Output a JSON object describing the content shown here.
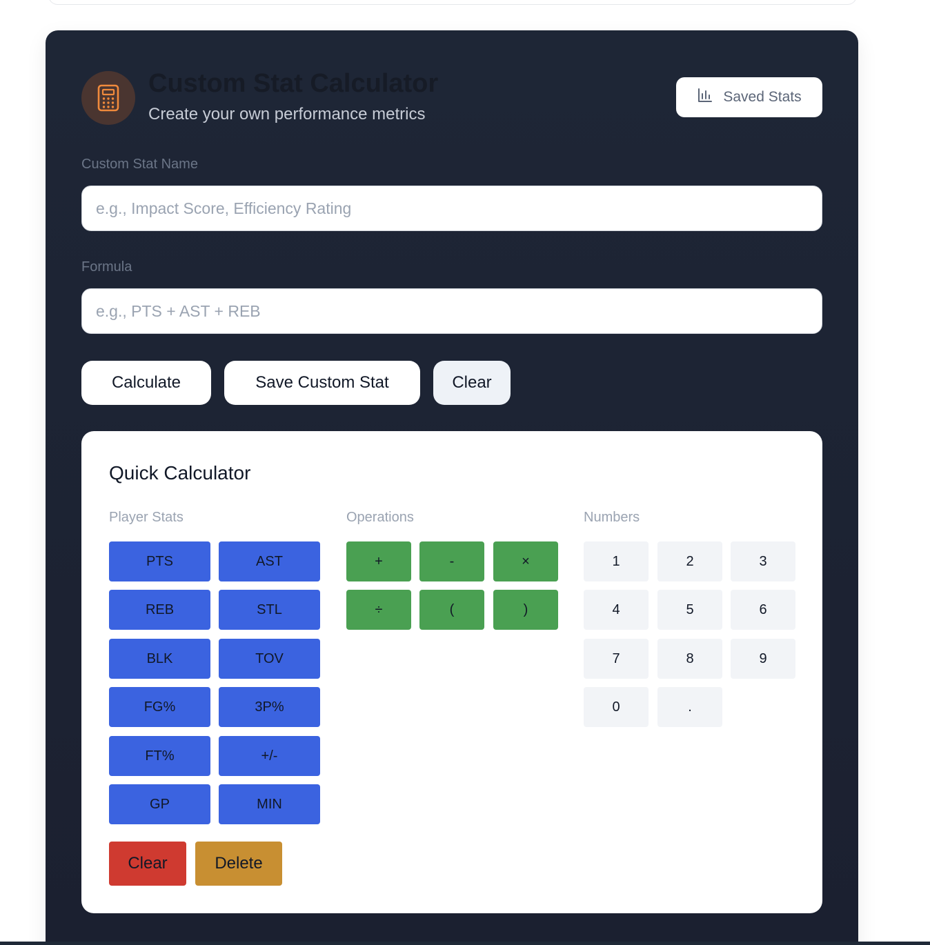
{
  "header": {
    "title": "Custom Stat Calculator",
    "subtitle": "Create your own performance metrics",
    "icon": "calculator-icon",
    "saved_stats_label": "Saved Stats",
    "saved_stats_icon": "bar-chart-icon"
  },
  "form": {
    "name_label": "Custom Stat Name",
    "name_placeholder": "e.g., Impact Score, Efficiency Rating",
    "name_value": "",
    "formula_label": "Formula",
    "formula_placeholder": "e.g., PTS + AST + REB",
    "formula_value": ""
  },
  "actions": {
    "calculate": "Calculate",
    "save": "Save Custom Stat",
    "clear": "Clear"
  },
  "quick_calc": {
    "title": "Quick Calculator",
    "player_stats_label": "Player Stats",
    "operations_label": "Operations",
    "numbers_label": "Numbers",
    "stats": [
      "PTS",
      "AST",
      "REB",
      "STL",
      "BLK",
      "TOV",
      "FG%",
      "3P%",
      "FT%",
      "+/-",
      "GP",
      "MIN"
    ],
    "operations": [
      "+",
      "-",
      "×",
      "÷",
      "(",
      ")"
    ],
    "numbers": [
      "1",
      "2",
      "3",
      "4",
      "5",
      "6",
      "7",
      "8",
      "9",
      "0",
      "."
    ],
    "clear_label": "Clear",
    "delete_label": "Delete"
  },
  "colors": {
    "panel_bg": "#1e2636",
    "stat_key": "#3b63e0",
    "op_key": "#4aa052",
    "num_key": "#f2f4f7",
    "clear_btn": "#cf3a30",
    "delete_btn": "#c88f32",
    "icon_accent": "#f08a3c"
  }
}
